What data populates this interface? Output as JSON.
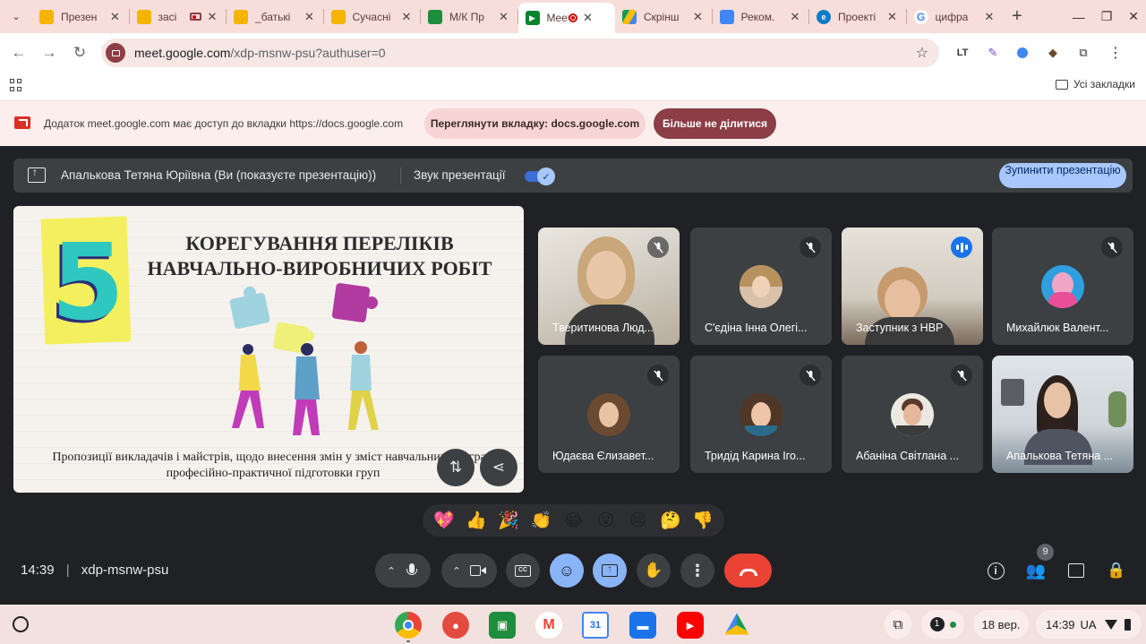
{
  "browser": {
    "tabs": [
      {
        "title": "Презен",
        "favicon": "slides-icon",
        "color": "#f4b400"
      },
      {
        "title": "засі",
        "favicon": "slides-icon",
        "color": "#f4b400"
      },
      {
        "title": "_батькі",
        "favicon": "slides-icon",
        "color": "#f4b400"
      },
      {
        "title": "Сучасні",
        "favicon": "slides-icon",
        "color": "#f4b400"
      },
      {
        "title": "М/К Пр",
        "favicon": "classroom-icon",
        "color": "#1e8e3e"
      },
      {
        "title": "Meet",
        "favicon": "meet-icon",
        "color": "#00832d",
        "active": true
      },
      {
        "title": "Скрінш",
        "favicon": "drive-icon",
        "color": "#1a73e8"
      },
      {
        "title": "Реком.",
        "favicon": "docs-icon",
        "color": "#4285f4"
      },
      {
        "title": "Проекті",
        "favicon": "edge-icon",
        "color": "#0f7bc4"
      },
      {
        "title": "цифра",
        "favicon": "google-icon",
        "color": "#ea4335"
      }
    ],
    "url_domain": "meet.google.com",
    "url_path": "/xdp-msnw-psu?authuser=0",
    "bookmarks_all": "Усі закладки"
  },
  "infobar": {
    "text": "Додаток meet.google.com має доступ до вкладки https://docs.google.com",
    "view_tab_label": "Переглянути вкладку: docs.google.com",
    "stop_sharing_label": "Більше не ділитися"
  },
  "presenting": {
    "text": "Апалькова Тетяна Юріївна (Ви (показуєте презентацію))",
    "sound_label": "Звук презентації",
    "sound_on": true,
    "stop_label": "Зупинити презентацію"
  },
  "slide": {
    "number": "5",
    "title_line1": "КОРЕГУВАННЯ ПЕРЕЛІКІВ",
    "title_line2": "НАВЧАЛЬНО-ВИРОБНИЧИХ РОБІТ",
    "caption_line1": "Пропозиції викладачів і майстрів, щодо внесення змін у зміст навчальних програм",
    "caption_line2": "професійно-практичної підготовки груп"
  },
  "participants": [
    {
      "name": "Тверитинова Люд...",
      "muted": true,
      "video": true
    },
    {
      "name": "С'єдіна Інна Олегі...",
      "muted": true,
      "video": false
    },
    {
      "name": "Заступник з НВР",
      "muted": false,
      "speaking": true,
      "video": true
    },
    {
      "name": "Михайлюк Валент...",
      "muted": true,
      "video": false
    },
    {
      "name": "Юдаєва Єлизавет...",
      "muted": true,
      "video": false
    },
    {
      "name": "Тридід Карина Іго...",
      "muted": true,
      "video": false
    },
    {
      "name": "Абаніна Світлана ...",
      "muted": true,
      "video": false
    },
    {
      "name": "Апалькова Тетяна ...",
      "muted": false,
      "video": true
    }
  ],
  "reactions": [
    "💖",
    "👍",
    "🎉",
    "👏",
    "😂",
    "😮",
    "😢",
    "🤔",
    "👎"
  ],
  "meeting": {
    "time": "14:39",
    "separator": "|",
    "code": "xdp-msnw-psu",
    "participant_count": "9"
  },
  "shelf": {
    "date": "18 вер.",
    "time": "14:39",
    "locale": "UA",
    "notification_count": "1"
  }
}
